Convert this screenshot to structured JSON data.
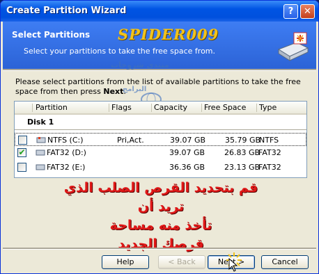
{
  "window": {
    "title": "Create Partition Wizard",
    "help_glyph": "?",
    "close_glyph": "✕"
  },
  "header": {
    "title": "Select Partitions",
    "subtitle": "Select your partitions to take the free space from.",
    "watermark_logo": "SPIDER009",
    "watermark_arabic": "منتدى شروحات",
    "watermark_arabic_small": "البرامج"
  },
  "instructions": {
    "pre": "Please select partitions from the list of available partitions to take the free space from then press ",
    "bold": "Next",
    "post": "."
  },
  "list": {
    "columns": [
      "Partition",
      "Flags",
      "Capacity",
      "Free Space",
      "Type"
    ],
    "disk_label": "Disk 1",
    "rows": [
      {
        "checked": false,
        "partition": "NTFS (C:)",
        "flags": "Pri,Act.",
        "capacity": "39.07 GB",
        "free": "35.79 GB",
        "type": "NTFS"
      },
      {
        "checked": true,
        "partition": "FAT32 (D:)",
        "flags": "",
        "capacity": "39.07 GB",
        "free": "26.83 GB",
        "type": "FAT32"
      },
      {
        "checked": false,
        "partition": "FAT32 (E:)",
        "flags": "",
        "capacity": "36.36 GB",
        "free": "23.13 GB",
        "type": "FAT32"
      }
    ]
  },
  "annotation_arabic": [
    "قم بتحديد القرص الصلب الذي تريد أن",
    "تأخذ منه مساحة",
    "قرصك الجديد"
  ],
  "buttons": {
    "help": "Help",
    "back": "< Back",
    "next": "Next >",
    "cancel": "Cancel"
  },
  "colors": {
    "title_bar": "#0054e3",
    "header": "#2c63d6",
    "dialog": "#ece9d8",
    "annotation": "#e01818",
    "logo": "#f2c31a"
  }
}
